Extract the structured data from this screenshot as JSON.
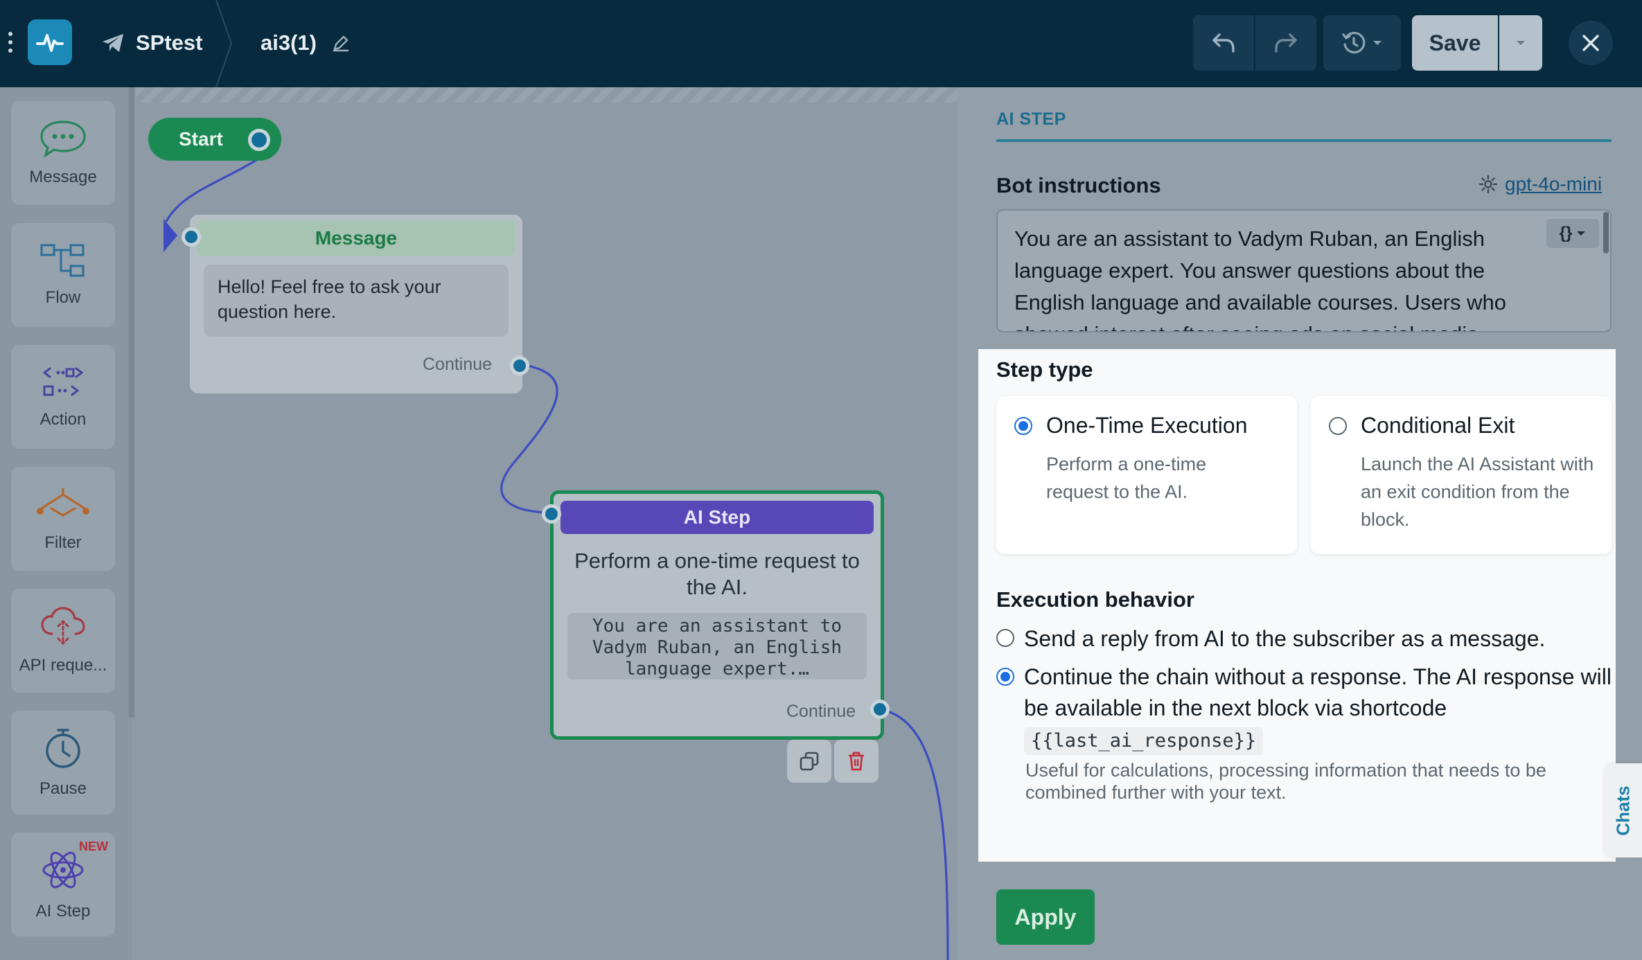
{
  "header": {
    "bot_name": "SPtest",
    "flow_name": "ai3(1)",
    "save_label": "Save"
  },
  "sidebar": {
    "items": [
      {
        "label": "Message",
        "icon": "chat-bubble-icon"
      },
      {
        "label": "Flow",
        "icon": "flow-icon"
      },
      {
        "label": "Action",
        "icon": "action-icon"
      },
      {
        "label": "Filter",
        "icon": "filter-icon"
      },
      {
        "label": "API reque...",
        "icon": "api-cloud-icon"
      },
      {
        "label": "Pause",
        "icon": "timer-icon"
      },
      {
        "label": "AI Step",
        "icon": "ai-atom-icon",
        "badge": "NEW"
      }
    ]
  },
  "canvas": {
    "start_label": "Start",
    "message_node": {
      "title": "Message",
      "text": "Hello! Feel free to ask your question here.",
      "continue_label": "Continue"
    },
    "ai_node": {
      "title": "AI Step",
      "description": "Perform a one-time request to the AI.",
      "preview": "You are an assistant to Vadym Ruban, an English language expert.…",
      "continue_label": "Continue"
    }
  },
  "panel": {
    "title": "AI STEP",
    "bot_instructions_label": "Bot instructions",
    "model": "gpt-4o-mini",
    "instructions": "You are an assistant to Vadym Ruban, an English language expert. You answer questions about the English language and available courses. Users who showed interest after seeing ads on social media",
    "step_type_label": "Step type",
    "step_types": [
      {
        "title": "One-Time Execution",
        "desc": "Perform a one-time request to the AI.",
        "selected": true
      },
      {
        "title": "Conditional Exit",
        "desc": "Launch the AI Assistant with an exit condition from the block.",
        "selected": false
      }
    ],
    "execution_label": "Execution behavior",
    "execution_options": [
      {
        "text": "Send a reply from AI to the subscriber as a message.",
        "selected": false
      },
      {
        "text": "Continue the chain without a response. The AI response will be available in the next block via shortcode",
        "selected": true
      }
    ],
    "shortcode": "{{last_ai_response}}",
    "hint": "Useful for calculations, processing information that needs to be combined further with your text.",
    "chats_tab": "Chats",
    "apply_label": "Apply"
  },
  "colors": {
    "topbar": "#072a3f",
    "accent_green": "#1a8a52",
    "ai_purple": "#5847b6",
    "link_blue": "#14507a",
    "radio_blue": "#1a6fe0"
  }
}
